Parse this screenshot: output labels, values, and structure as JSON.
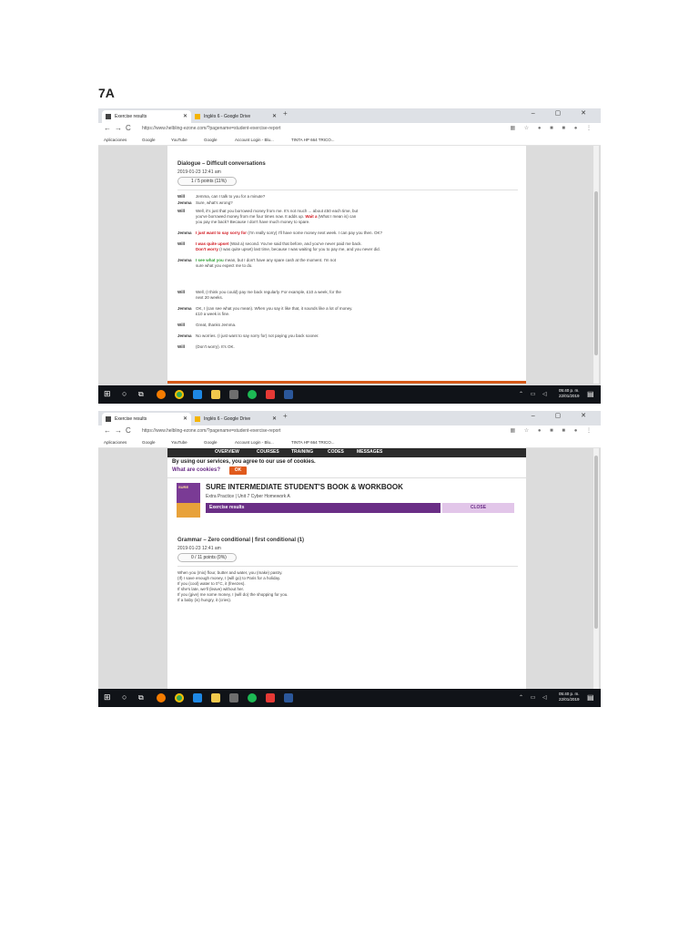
{
  "document": {
    "heading": "7A"
  },
  "browser": {
    "tabs": [
      {
        "title": "Exercise results",
        "active": true
      },
      {
        "title": "Inglés 6 - Google Drive",
        "active": false
      }
    ],
    "new_tab_glyph": "+",
    "window_controls": "– ▢ ✕",
    "nav": {
      "back": "←",
      "forward": "→",
      "reload": "C"
    },
    "url": "https://www.helbling-ezone.com/?pagename=student-exercise-report",
    "bookmarks": [
      "Aplicaciones",
      "Google",
      "YouTube",
      "Google",
      "Account Login - Blu...",
      "TINTA HP 664 TRICO..."
    ]
  },
  "taskbar": {
    "clock_time": "05:40 p. m.",
    "clock_date": "22/01/2019"
  },
  "screen1": {
    "exercise_title": "Dialogue – Difficult conversations",
    "date": "2019-01-23  12:41 am",
    "points": "1 / 5 points (11%)",
    "dialogue": [
      {
        "speaker": "Will",
        "parts": [
          {
            "text": "Jemma, can I talk to you for a minute?"
          }
        ]
      },
      {
        "speaker": "Jemma",
        "parts": [
          {
            "text": "Sure, what's wrong?"
          }
        ]
      },
      {
        "speaker": "Will",
        "parts": [
          {
            "text": "Well, it's just that you borrowed money from me. It's not much ... about £50 each time, but"
          }
        ]
      },
      {
        "speaker": "",
        "parts": [
          {
            "text": "you've borrowed money from me four times now. It adds up. "
          },
          {
            "text": "Wait a",
            "style": "red"
          },
          {
            "text": " (What I mean is) can"
          }
        ]
      },
      {
        "speaker": "",
        "parts": [
          {
            "text": "you pay me back? Because I don't have much money to spare."
          }
        ]
      },
      {
        "speaker": "Jemma",
        "parts": [
          {
            "text": "I just want to say sorry for",
            "style": "red"
          },
          {
            "text": " (I'm really sorry) I'll have some money next week. I can pay you then. OK?"
          }
        ]
      },
      {
        "speaker": "Will",
        "parts": [
          {
            "text": "I was quite upset",
            "style": "red"
          },
          {
            "text": " (Wait a) second. You've said that before, and you've never paid me back."
          }
        ]
      },
      {
        "speaker": "",
        "parts": [
          {
            "text": "Don't worry",
            "style": "red"
          },
          {
            "text": " (I was quite upset) last time, because I was waiting for you to pay me, and you never did."
          }
        ]
      },
      {
        "speaker": "Jemma",
        "parts": [
          {
            "text": "I see what you",
            "style": "green"
          },
          {
            "text": " mean, but I don't have any spare cash at the moment. I'm not"
          }
        ]
      },
      {
        "speaker": "",
        "parts": [
          {
            "text": "sure what you expect me to do."
          }
        ]
      },
      {
        "speaker": "Will",
        "parts": [
          {
            "text": "Well, (I think you could) pay me back regularly. For example, £10 a week, for the"
          }
        ]
      },
      {
        "speaker": "",
        "parts": [
          {
            "text": "next 20 weeks."
          }
        ]
      },
      {
        "speaker": "Jemma",
        "parts": [
          {
            "text": "OK, I (can see what you mean). When you say it like that, it sounds like a lot of money."
          }
        ]
      },
      {
        "speaker": "",
        "parts": [
          {
            "text": "£10 a week is fine."
          }
        ]
      },
      {
        "speaker": "Will",
        "parts": [
          {
            "text": "Great, thanks Jemma."
          }
        ]
      },
      {
        "speaker": "Jemma",
        "parts": [
          {
            "text": "No worries. (I just want to say sorry for) not paying you back sooner."
          }
        ]
      },
      {
        "speaker": "Will",
        "parts": [
          {
            "text": "(Don't worry). It's OK."
          }
        ]
      }
    ]
  },
  "screen2": {
    "nav": [
      "OVERVIEW",
      "COURSES",
      "TRAINING",
      "CODES",
      "MESSAGES"
    ],
    "cookie_message": "By using our services, you agree to our use of cookies.",
    "cookie_link": "What are cookies?",
    "ok_label": "OK",
    "book_cover_text": "SURE",
    "book_title": "SURE INTERMEDIATE STUDENT'S BOOK & WORKBOOK",
    "book_subtitle": "Extra Practice | Unit 7 Cyber Homework A",
    "results_label": "Exercise results",
    "close_label": "CLOSE",
    "exercise_title": "Grammar – Zero conditional | first conditional (1)",
    "date": "2019-01-23  12:41 am",
    "points": "0 / 11 points (0%)",
    "lines": [
      "When you (mix) flour, butter and water, you (make) pastry.",
      "(If) I save enough money, I (will go) to Paris for a holiday.",
      "If you (cool) water to 0°C, it (freezes).",
      "If she's late, we'll (leave) without her.",
      "If you (give) me some money, I (will do) the shopping for you.",
      "If a baby (is) hungry, it (cries)."
    ]
  },
  "colors": {
    "accent_purple": "#6a2e86",
    "ok_orange": "#e05a1c",
    "red_text": "#d0141c",
    "green_text": "#2f9e33"
  }
}
